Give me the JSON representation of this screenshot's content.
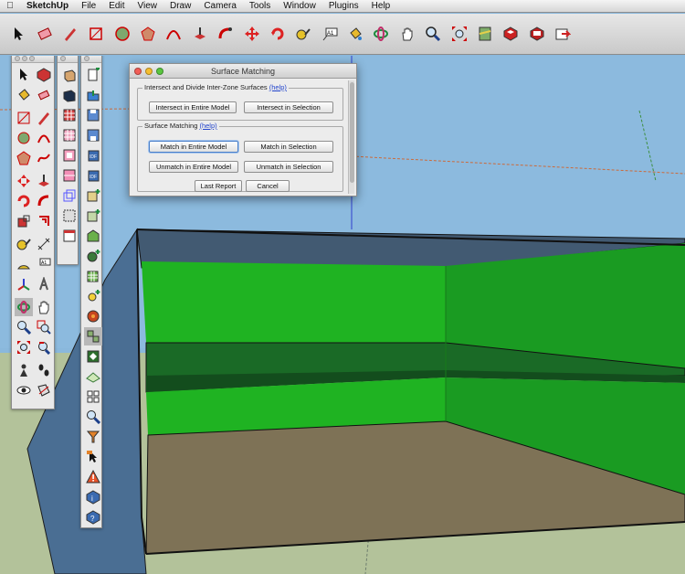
{
  "menubar": {
    "app": "SketchUp",
    "items": [
      "File",
      "Edit",
      "View",
      "Draw",
      "Camera",
      "Tools",
      "Window",
      "Plugins",
      "Help"
    ]
  },
  "toolbar": {
    "icons": [
      "select-arrow-icon",
      "eraser-icon",
      "pencil-icon",
      "rectangle-icon",
      "circle-icon",
      "polygon-icon",
      "arc-icon",
      "push-pull-icon",
      "follow-me-icon",
      "move-icon",
      "rotate-icon",
      "tape-measure-icon",
      "text-label-icon",
      "paint-bucket-icon",
      "orbit-icon",
      "pan-hand-icon",
      "zoom-icon",
      "zoom-extents-icon",
      "map-icon",
      "component-icon-1",
      "component-icon-2",
      "export-icon"
    ]
  },
  "dialog": {
    "title": "Surface Matching",
    "intersect_group": {
      "title": "Intersect and Divide Inter-Zone Surfaces",
      "help": "(help)",
      "btn_entire": "Intersect in Entire Model",
      "btn_selection": "Intersect in Selection"
    },
    "match_group": {
      "title": "Surface Matching",
      "help": "(help)",
      "btn_match_entire": "Match in Entire Model",
      "btn_match_selection": "Match in Selection",
      "btn_unmatch_entire": "Unmatch in Entire Model",
      "btn_unmatch_selection": "Unmatch in Selection"
    },
    "btn_last_report": "Last Report",
    "btn_cancel": "Cancel"
  },
  "colors": {
    "sky": "#8ab8dc",
    "ground": "#b4c39a",
    "wall_green": "#1fb21f",
    "wall_blue": "#4c6e8e",
    "floor": "#7f7356"
  }
}
